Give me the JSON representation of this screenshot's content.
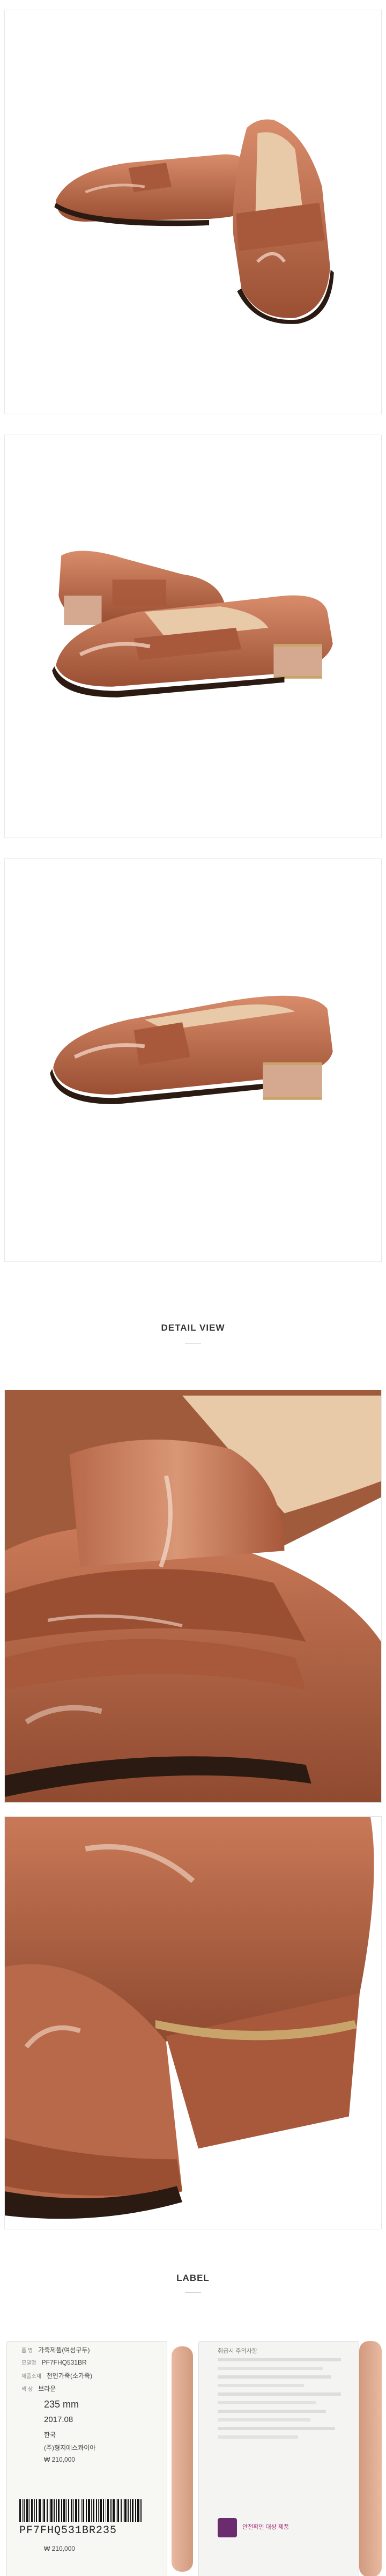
{
  "page": {
    "background": "#ffffff",
    "shoe_colors": {
      "body": "#b8694a",
      "highlight": "#f0d0bf",
      "sole": "#2a1a12",
      "heel_trim": "#c9a46a",
      "lining": "#e8c9a8"
    }
  },
  "photos": [
    {
      "name": "product-photo-side-pair"
    },
    {
      "name": "product-photo-front-pair"
    },
    {
      "name": "product-photo-side-single"
    },
    {
      "name": "detail-photo-vamp"
    },
    {
      "name": "detail-photo-heel"
    }
  ],
  "detail_section": {
    "title": "DETAIL VIEW"
  },
  "label_section": {
    "title": "LABEL",
    "tag_front": {
      "rows": [
        {
          "key": "품 명",
          "value": "가죽제품(여성구두)"
        },
        {
          "key": "모델명",
          "value": "PF7FHQ531BR"
        },
        {
          "key": "제품소재",
          "value": "천연가죽(소가죽)"
        },
        {
          "key": "색 상",
          "value": "브라운"
        }
      ],
      "size": "235 mm",
      "date": "2017.08",
      "origin": "한국",
      "maker": "(주)형지에스콰이아",
      "price": "₩ 210,000",
      "barcode": "PF7FHQ531BR235",
      "price_bottom": "₩ 210,000"
    },
    "tag_back": {
      "heading": "취급시 주의사항",
      "kc_text": "안전확인 대상 제품"
    }
  }
}
